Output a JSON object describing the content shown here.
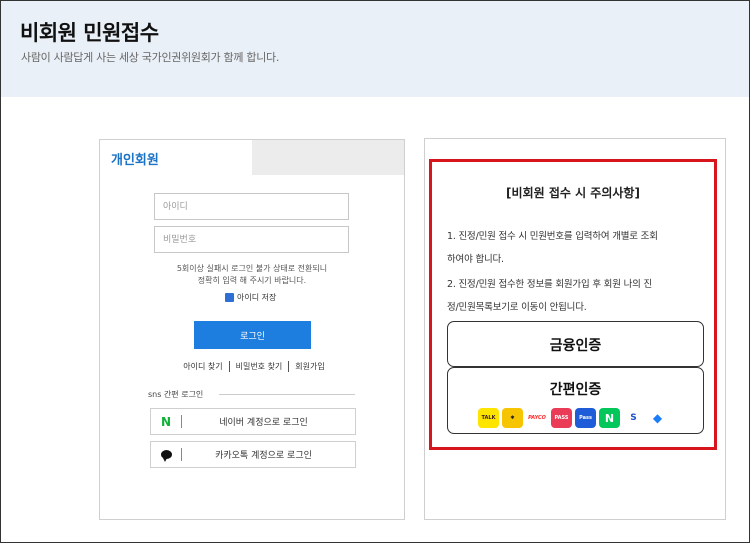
{
  "header": {
    "title": "비회원 민원접수",
    "subtitle": "사람이 사람답게 사는 세상 국가인권위원회가 함께 합니다."
  },
  "login": {
    "tab_active": "개인회원",
    "id_placeholder": "아이디",
    "pw_placeholder": "비밀번호",
    "warning_line1": "5회이상 실패시 로그인 불가 상태로 전환되니",
    "warning_line2": "정확히 입력 해 주시기 바랍니다.",
    "save_id_label": "아이디 저장",
    "login_button": "로그인",
    "links": [
      "아이디 찾기",
      "비밀번호 찾기",
      "회원가입"
    ],
    "sns_label": "sns 간편 로그인",
    "naver_login": "네이버 계정으로 로그인",
    "kakao_login": "카카오톡 계정으로 로그인"
  },
  "notice": {
    "title": "[비회원 접수 시 주의사항]",
    "item1_line1": "1. 진정/민원 접수 시 민원번호를 입력하여 개별로 조회",
    "item1_line2": "하여야 합니다.",
    "item2_line1": "2. 진정/민원 접수한 정보를 회원가입 후 회원 나의 진",
    "item2_line2": "정/민원목록보기로 이동이 안됩니다.",
    "financial_auth": "금융인증",
    "simple_auth": "간편인증",
    "providers": [
      {
        "name": "kakao-talk",
        "label": "TALK"
      },
      {
        "name": "pass-yellow",
        "label": "✱"
      },
      {
        "name": "payco",
        "label": "PAYCO"
      },
      {
        "name": "pass-red",
        "label": "PASS"
      },
      {
        "name": "samsung-pass",
        "label": "Pass"
      },
      {
        "name": "naver",
        "label": "N"
      },
      {
        "name": "shinhan",
        "label": "S"
      },
      {
        "name": "toss",
        "label": "◆"
      }
    ]
  },
  "colors": {
    "accent_blue": "#1d7ee0",
    "highlight_red": "#d8141d",
    "header_bg": "#eaf0f7"
  }
}
